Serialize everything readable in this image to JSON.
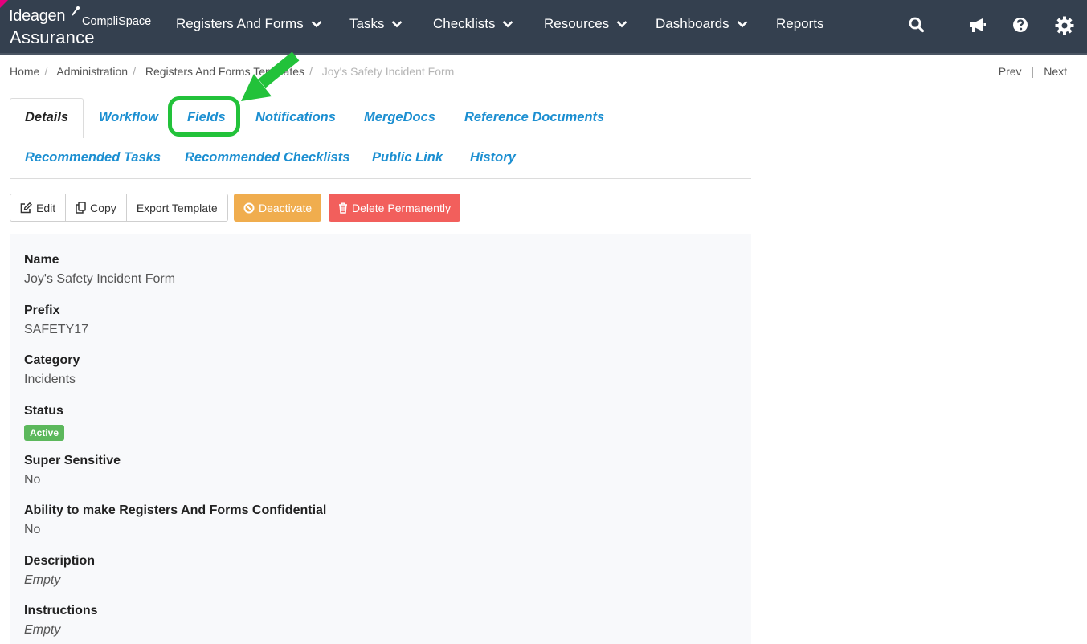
{
  "app": {
    "brand": "Ideagen",
    "product": "CompliSpace",
    "subproduct": "Assurance"
  },
  "nav": {
    "items": [
      {
        "label": "Registers And Forms",
        "has_menu": true
      },
      {
        "label": "Tasks",
        "has_menu": true
      },
      {
        "label": "Checklists",
        "has_menu": true
      },
      {
        "label": "Resources",
        "has_menu": true
      },
      {
        "label": "Dashboards",
        "has_menu": true
      },
      {
        "label": "Reports",
        "has_menu": false
      }
    ],
    "icons": [
      "search-icon",
      "megaphone-icon",
      "help-icon",
      "gear-icon"
    ]
  },
  "breadcrumb": {
    "items": [
      "Home",
      "Administration",
      "Registers And Forms Templates",
      "Joy's Safety Incident Form"
    ],
    "separator": "/"
  },
  "pager": {
    "prev": "Prev",
    "separator": "|",
    "next": "Next"
  },
  "tabs": {
    "row1": [
      "Details",
      "Workflow",
      "Fields",
      "Notifications",
      "MergeDocs",
      "Reference Documents"
    ],
    "row2": [
      "Recommended Tasks",
      "Recommended Checklists",
      "Public Link",
      "History"
    ],
    "active": "Details",
    "highlighted": "Fields"
  },
  "actions": {
    "edit": "Edit",
    "copy": "Copy",
    "export": "Export Template",
    "deactivate": "Deactivate",
    "delete": "Delete Permanently"
  },
  "details": {
    "name": {
      "label": "Name",
      "value": "Joy's Safety Incident Form"
    },
    "prefix": {
      "label": "Prefix",
      "value": "SAFETY17"
    },
    "category": {
      "label": "Category",
      "value": "Incidents"
    },
    "status": {
      "label": "Status",
      "value": "Active"
    },
    "super_sensitive": {
      "label": "Super Sensitive",
      "value": "No"
    },
    "confidential": {
      "label": "Ability to make Registers And Forms Confidential",
      "value": "No"
    },
    "description": {
      "label": "Description",
      "value": "Empty"
    },
    "instructions": {
      "label": "Instructions",
      "value": "Empty"
    }
  },
  "colors": {
    "topbar": "#34404f",
    "tab_link": "#1c8fd1",
    "warning": "#f0ad4e",
    "danger": "#f25f5c",
    "success": "#5cb85c",
    "highlight": "#22c23a"
  }
}
